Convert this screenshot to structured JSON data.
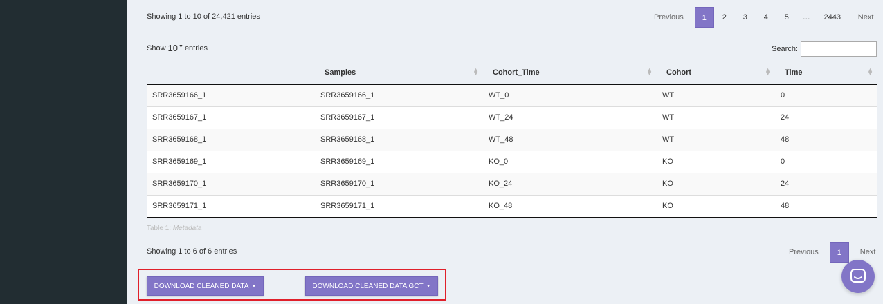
{
  "top_table": {
    "info": "Showing 1 to 10 of 24,421 entries",
    "pagination": {
      "previous": "Previous",
      "pages": [
        "1",
        "2",
        "3",
        "4",
        "5",
        "…",
        "2443"
      ],
      "next": "Next"
    }
  },
  "metadata_table": {
    "length": {
      "show": "Show",
      "value": "10",
      "entries": "entries"
    },
    "search": {
      "label": "Search:",
      "value": ""
    },
    "columns": [
      "",
      "Samples",
      "Cohort_Time",
      "Cohort",
      "Time"
    ],
    "rows": [
      [
        "SRR3659166_1",
        "SRR3659166_1",
        "WT_0",
        "WT",
        "0"
      ],
      [
        "SRR3659167_1",
        "SRR3659167_1",
        "WT_24",
        "WT",
        "24"
      ],
      [
        "SRR3659168_1",
        "SRR3659168_1",
        "WT_48",
        "WT",
        "48"
      ],
      [
        "SRR3659169_1",
        "SRR3659169_1",
        "KO_0",
        "KO",
        "0"
      ],
      [
        "SRR3659170_1",
        "SRR3659170_1",
        "KO_24",
        "KO",
        "24"
      ],
      [
        "SRR3659171_1",
        "SRR3659171_1",
        "KO_48",
        "KO",
        "48"
      ]
    ],
    "caption": {
      "prefix": "Table 1: ",
      "title": "Metadata"
    },
    "info": "Showing 1 to 6 of 6 entries",
    "pagination": {
      "previous": "Previous",
      "pages": [
        "1"
      ],
      "next": "Next"
    }
  },
  "buttons": {
    "download_cleaned": "DOWNLOAD CLEANED DATA",
    "download_cleaned_gct": "DOWNLOAD CLEANED DATA GCT"
  },
  "icons": {
    "chat": "chat-icon",
    "sort": "sort-icon",
    "caret": "caret-down-icon"
  },
  "colors": {
    "accent": "#8275c7",
    "sidebar": "#222d32",
    "highlight": "#e0202a"
  }
}
